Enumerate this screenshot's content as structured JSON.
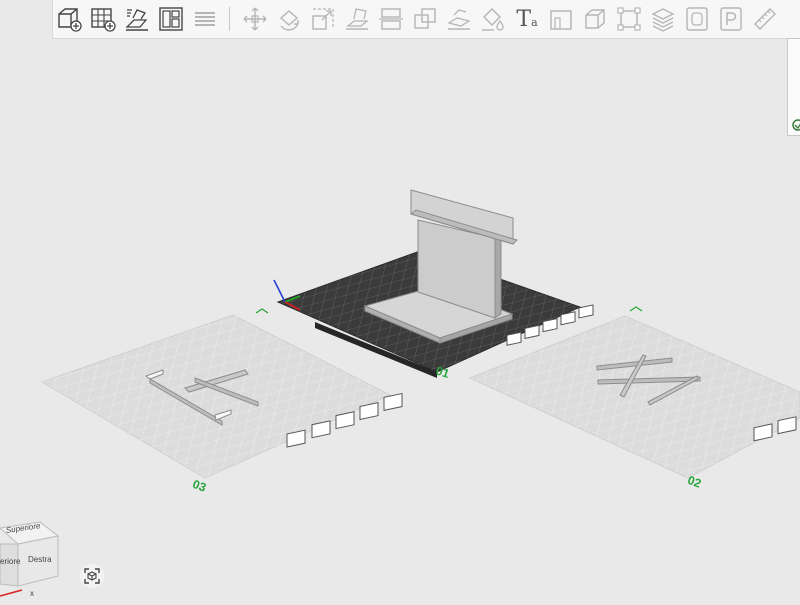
{
  "toolbar": {
    "items": [
      {
        "id": "add-object",
        "icon": "add-cube-icon",
        "enabled": true
      },
      {
        "id": "add-plate",
        "icon": "grid-plus-icon",
        "enabled": true
      },
      {
        "id": "auto-orient",
        "icon": "auto-orient-icon",
        "enabled": true
      },
      {
        "id": "arrange",
        "icon": "arrange-icon",
        "enabled": true
      },
      {
        "id": "split-plates",
        "icon": "layers-icon",
        "enabled": false
      },
      {
        "id": "move",
        "icon": "move-icon",
        "enabled": false
      },
      {
        "id": "rotate",
        "icon": "rotate-icon",
        "enabled": false
      },
      {
        "id": "scale",
        "icon": "scale-icon",
        "enabled": false
      },
      {
        "id": "lay-on-face",
        "icon": "lay-on-face-icon",
        "enabled": false
      },
      {
        "id": "cut",
        "icon": "cut-icon",
        "enabled": false
      },
      {
        "id": "boolean",
        "icon": "boolean-icon",
        "enabled": false
      },
      {
        "id": "support-paint",
        "icon": "support-paint-icon",
        "enabled": false
      },
      {
        "id": "color-paint",
        "icon": "paint-bucket-icon",
        "enabled": false
      },
      {
        "id": "text",
        "icon": "text-icon",
        "enabled": true
      },
      {
        "id": "measure",
        "icon": "measure-icon",
        "enabled": false
      },
      {
        "id": "assembly",
        "icon": "cube-assembly-icon",
        "enabled": false
      },
      {
        "id": "fix-model",
        "icon": "fix-model-icon",
        "enabled": false
      },
      {
        "id": "variable-layer",
        "icon": "layer-stack-icon",
        "enabled": false
      },
      {
        "id": "seam",
        "icon": "seam-icon",
        "enabled": false
      },
      {
        "id": "simplify",
        "icon": "simplify-icon",
        "enabled": false
      },
      {
        "id": "ruler",
        "icon": "ruler-icon",
        "enabled": false
      }
    ],
    "text_tool_label": "T",
    "text_tool_sub": "a"
  },
  "plates": [
    {
      "number": "01",
      "selected": true
    },
    {
      "number": "02",
      "selected": false
    },
    {
      "number": "03",
      "selected": false
    }
  ],
  "view_cube": {
    "top": "Superiore",
    "left": "eriore",
    "right": "Destra"
  },
  "axes": {
    "x": "x"
  },
  "colors": {
    "background": "#e9e9e9",
    "active_plate": "#3b3b3b",
    "inactive_plate": "#dcdcdc",
    "plate_number": "#27a63c",
    "model": "#c9c9c9"
  }
}
